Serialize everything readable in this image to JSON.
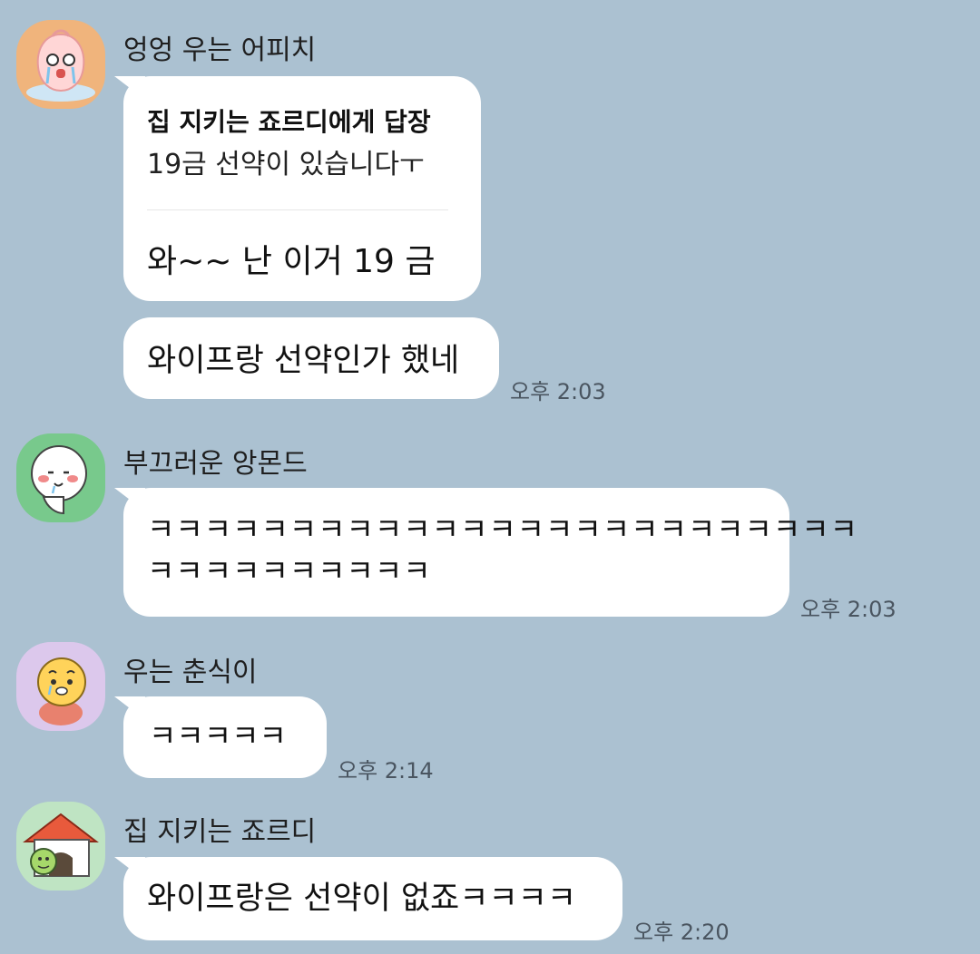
{
  "colors": {
    "background": "#abc1d1",
    "bubble": "#ffffff",
    "time_text": "#4a5560"
  },
  "messages": [
    {
      "sender": "엉엉 우는 어피치",
      "avatar_icon": "crying-peach-avatar-icon",
      "reply": {
        "title": "집 지키는 죠르디에게 답장",
        "quote": "19금 선약이 있습니다ㅜ",
        "text": "와~~  난 이거 19 금"
      },
      "followup": "와이프랑 선약인가 했네",
      "time": "오후 2:03"
    },
    {
      "sender": "부끄러운 앙몬드",
      "avatar_icon": "shy-angmond-avatar-icon",
      "lines": [
        "ㅋㅋㅋㅋㅋㅋㅋㅋㅋㅋㅋㅋㅋㅋㅋㅋㅋㅋㅋㅋㅋㅋㅋㅋㅋ",
        "ㅋㅋㅋㅋㅋㅋㅋㅋㅋㅋ"
      ],
      "time": "오후 2:03"
    },
    {
      "sender": "우는 춘식이",
      "avatar_icon": "crying-choonsik-avatar-icon",
      "text": "ㅋㅋㅋㅋㅋ",
      "time": "오후 2:14"
    },
    {
      "sender": "집 지키는 죠르디",
      "avatar_icon": "doghouse-jordy-avatar-icon",
      "text": "와이프랑은 선약이 없죠ㅋㅋㅋㅋ",
      "time": "오후 2:20"
    }
  ]
}
